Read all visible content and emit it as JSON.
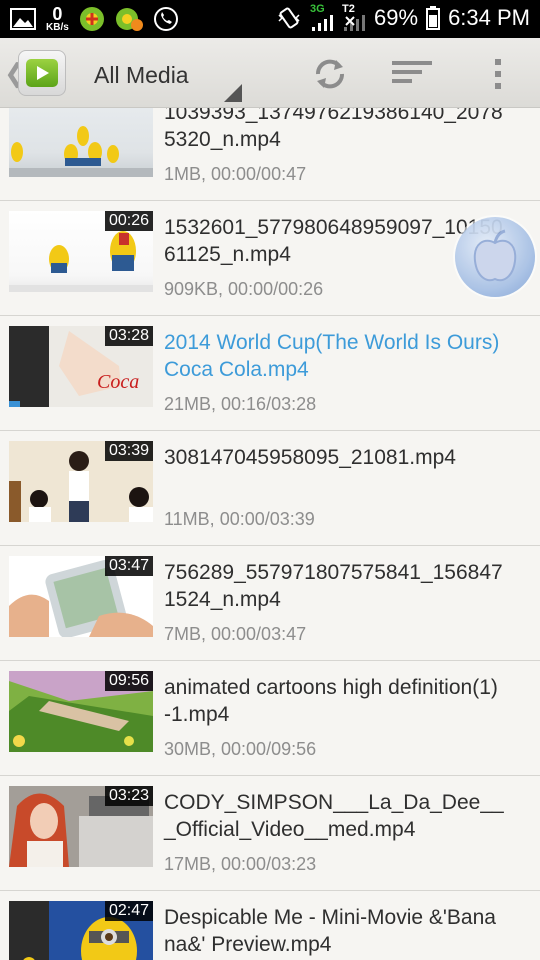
{
  "status_bar": {
    "speed_value": "0",
    "speed_unit": "KB/s",
    "network": "3G",
    "sim2": "T2",
    "battery_percent": "69%",
    "time": "6:34 PM"
  },
  "action_bar": {
    "title": "All Media",
    "icons": [
      "media-player-app-icon",
      "refresh-icon",
      "sort-icon",
      "overflow-menu-icon"
    ],
    "accent": "#6fb82a"
  },
  "videos": [
    {
      "title": "1039393_1374976219386140_20785320_n.mp4",
      "meta": "1MB, 00:00/00:47",
      "duration": "",
      "playing": false,
      "progress": 0
    },
    {
      "title": "1532601_577980648959097_1015061125_n.mp4",
      "meta": "909KB, 00:00/00:26",
      "duration": "00:26",
      "playing": false,
      "progress": 0
    },
    {
      "title": "2014 World Cup(The World Is Ours)Coca Cola.mp4",
      "meta": "21MB, 00:16/03:28",
      "duration": "03:28",
      "playing": true,
      "progress": 0.077
    },
    {
      "title": "308147045958095_21081.mp4",
      "meta": "11MB, 00:00/03:39",
      "duration": "03:39",
      "playing": false,
      "progress": 0
    },
    {
      "title": "756289_557971807575841_1568471524_n.mp4",
      "meta": "7MB, 00:00/03:47",
      "duration": "03:47",
      "playing": false,
      "progress": 0
    },
    {
      "title": "animated cartoons high definition(1)-1.mp4",
      "meta": "30MB, 00:00/09:56",
      "duration": "09:56",
      "playing": false,
      "progress": 0
    },
    {
      "title": "CODY_SIMPSON___La_Da_Dee___Official_Video__med.mp4",
      "meta": "17MB, 00:00/03:23",
      "duration": "03:23",
      "playing": false,
      "progress": 0
    },
    {
      "title": "Despicable Me - Mini-Movie &'Banana&' Preview.mp4",
      "meta": "",
      "duration": "02:47",
      "playing": false,
      "progress": 0
    }
  ],
  "colors": {
    "playing_title": "#3d9bd9",
    "progress_bar": "#3a91d5",
    "background": "#f6f5f2"
  }
}
